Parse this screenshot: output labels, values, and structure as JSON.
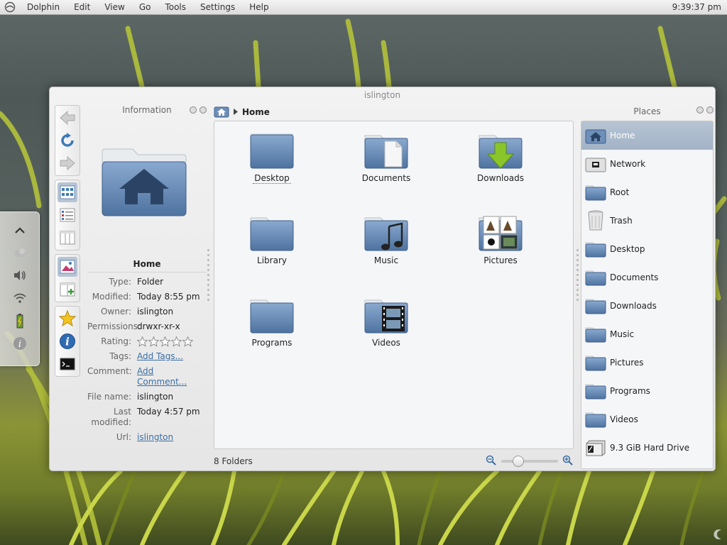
{
  "menubar": {
    "app": "Dolphin",
    "items": [
      "Edit",
      "View",
      "Go",
      "Tools",
      "Settings",
      "Help"
    ],
    "clock": "9:39:37 pm"
  },
  "window": {
    "title": "islington"
  },
  "info_panel": {
    "title": "Information",
    "name": "Home",
    "props": [
      {
        "key": "Type:",
        "value": "Folder"
      },
      {
        "key": "Modified:",
        "value": "Today 8:55 pm"
      },
      {
        "key": "Owner:",
        "value": "islington"
      },
      {
        "key": "Permissions:",
        "value": "drwxr-xr-x"
      },
      {
        "key": "Rating:",
        "value": ""
      },
      {
        "key": "Tags:",
        "value": "Add Tags..."
      },
      {
        "key": "Comment:",
        "value": "Add Comment..."
      },
      {
        "key": "File name:",
        "value": "islington"
      },
      {
        "key": "Last modified:",
        "value": "Today 4:57 pm"
      },
      {
        "key": "Url:",
        "value": "islington"
      }
    ],
    "rating_stars": 0
  },
  "breadcrumb": {
    "current": "Home"
  },
  "files": [
    {
      "name": "Desktop",
      "icon": "folder-icon"
    },
    {
      "name": "Documents",
      "icon": "folder-documents-icon"
    },
    {
      "name": "Downloads",
      "icon": "folder-downloads-icon"
    },
    {
      "name": "Library",
      "icon": "folder-icon"
    },
    {
      "name": "Music",
      "icon": "folder-music-icon"
    },
    {
      "name": "Pictures",
      "icon": "folder-pictures-icon"
    },
    {
      "name": "Programs",
      "icon": "folder-icon"
    },
    {
      "name": "Videos",
      "icon": "folder-videos-icon"
    }
  ],
  "statusbar": {
    "text": "8 Folders",
    "zoom_level": 0.25
  },
  "places_panel": {
    "title": "Places",
    "items": [
      {
        "label": "Home",
        "icon": "home-icon",
        "active": true
      },
      {
        "label": "Network",
        "icon": "network-icon"
      },
      {
        "label": "Root",
        "icon": "folder-icon"
      },
      {
        "label": "Trash",
        "icon": "trash-icon"
      },
      {
        "label": "Desktop",
        "icon": "folder-icon"
      },
      {
        "label": "Documents",
        "icon": "folder-icon"
      },
      {
        "label": "Downloads",
        "icon": "folder-icon"
      },
      {
        "label": "Music",
        "icon": "folder-icon"
      },
      {
        "label": "Pictures",
        "icon": "folder-icon"
      },
      {
        "label": "Programs",
        "icon": "folder-icon"
      },
      {
        "label": "Videos",
        "icon": "folder-icon"
      },
      {
        "label": "9.3 GiB Hard Drive",
        "icon": "hard-drive-icon"
      }
    ]
  },
  "colors": {
    "accent": "#b6c4d4",
    "folder": "#5f83ad",
    "link": "#3a6ea5"
  }
}
